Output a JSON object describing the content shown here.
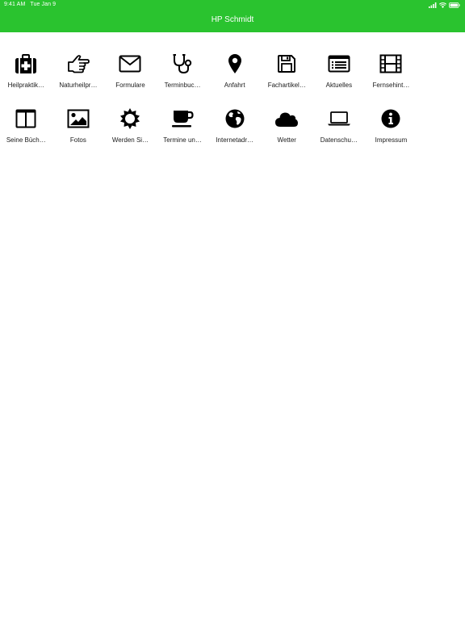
{
  "status_bar": {
    "time": "9:41 AM",
    "date": "Tue Jan 9"
  },
  "header": {
    "title": "HP Schmidt",
    "background": "#2ac32f"
  },
  "tiles": [
    {
      "label": "Heilpraktik…",
      "icon": "first-aid-kit-icon"
    },
    {
      "label": "Naturheilpr…",
      "icon": "pointing-hand-icon"
    },
    {
      "label": "Formulare",
      "icon": "envelope-icon"
    },
    {
      "label": "Terminbuc…",
      "icon": "stethoscope-icon"
    },
    {
      "label": "Anfahrt",
      "icon": "map-marker-icon"
    },
    {
      "label": "Fachartikel…",
      "icon": "floppy-disk-icon"
    },
    {
      "label": "Aktuelles",
      "icon": "list-window-icon"
    },
    {
      "label": "Fernsehint…",
      "icon": "film-strip-icon"
    },
    {
      "label": "Seine Büch…",
      "icon": "columns-icon"
    },
    {
      "label": "Fotos",
      "icon": "picture-icon"
    },
    {
      "label": "Werden Si…",
      "icon": "sun-icon"
    },
    {
      "label": "Termine un…",
      "icon": "coffee-cup-icon"
    },
    {
      "label": "Internetadr…",
      "icon": "globe-icon"
    },
    {
      "label": "Wetter",
      "icon": "cloud-icon"
    },
    {
      "label": "Datenschu…",
      "icon": "laptop-icon"
    },
    {
      "label": "Impressum",
      "icon": "info-circle-icon"
    }
  ]
}
